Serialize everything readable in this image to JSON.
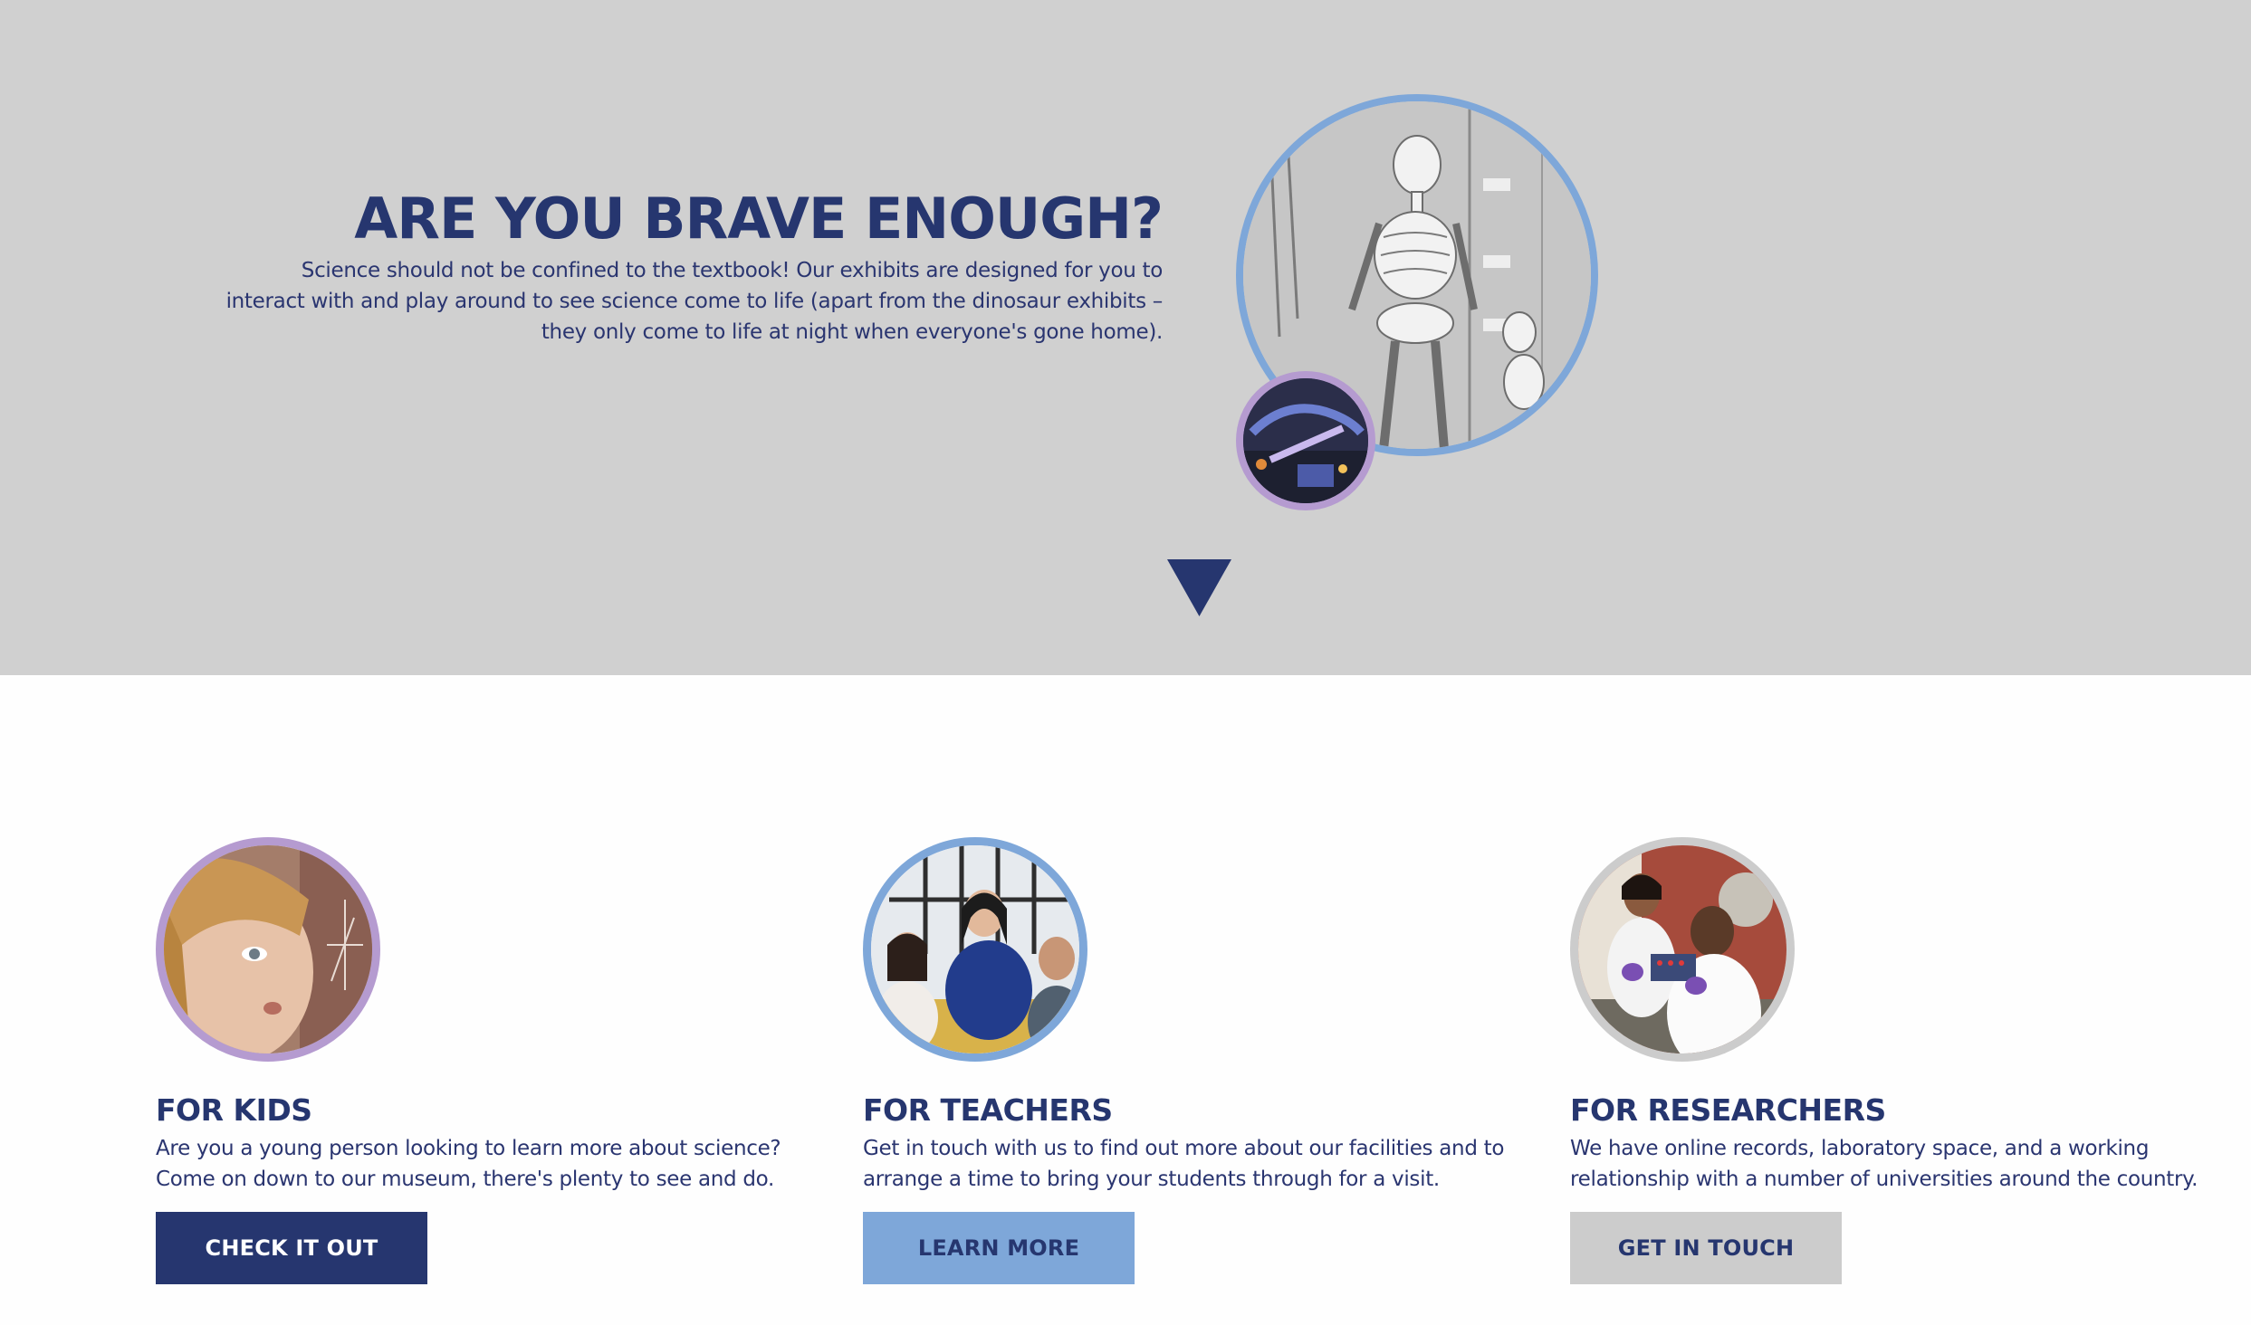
{
  "hero": {
    "title": "ARE YOU BRAVE ENOUGH?",
    "body": "Science should not be confined to the textbook! Our exhibits are designed for you to interact with and play around to see science come to life (apart from the dinosaur exhibits – they only come to life at night when everyone's gone home).",
    "main_image_icon": "skeleton-exhibit-photo",
    "secondary_image_icon": "dinosaur-exhibit-photo",
    "scroll_icon": "triangle-down-icon"
  },
  "cards": [
    {
      "title": "FOR KIDS",
      "body": "Are you a young person looking to learn more about science? Come on down to our museum, there's plenty to see and do.",
      "button": "CHECK IT OUT",
      "ring_color": "#b59bd0",
      "image_icon": "child-photo"
    },
    {
      "title": "FOR TEACHERS",
      "body": "Get in touch with us to find out more about our facilities and to arrange a time to bring your students through for a visit.",
      "button": "LEARN MORE",
      "ring_color": "#7ea7d9",
      "image_icon": "teacher-students-photo"
    },
    {
      "title": "FOR RESEARCHERS",
      "body": "We have online records, laboratory space, and a working relationship with a number of universities around the country.",
      "button": "GET IN TOUCH",
      "ring_color": "#cccccc",
      "image_icon": "researchers-lab-photo"
    }
  ],
  "colors": {
    "navy": "#26366f",
    "light_blue": "#7ea7d9",
    "lilac": "#b59bd0",
    "hero_bg": "#d0d0d0",
    "grey_button": "#cccccc"
  }
}
